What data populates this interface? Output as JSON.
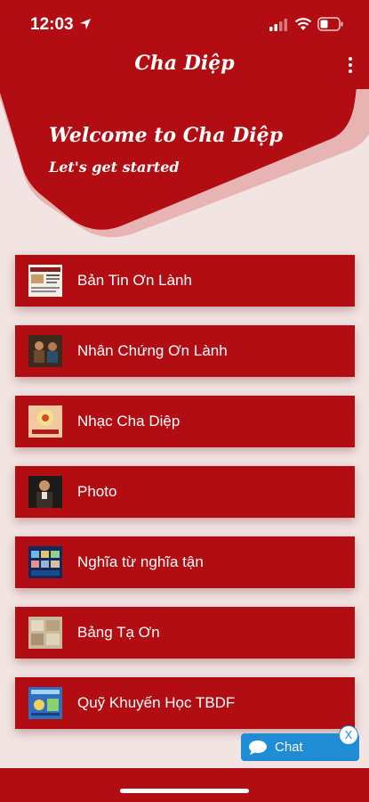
{
  "status_bar": {
    "time": "12:03"
  },
  "header": {
    "title": "Cha Diệp"
  },
  "banner": {
    "welcome": "Welcome to Cha Diệp",
    "subtitle": "Let's get started"
  },
  "menu": [
    {
      "label": "Bản Tin Ơn Lành",
      "icon": "newsletter-thumbnail"
    },
    {
      "label": "Nhân Chứng Ơn Lành",
      "icon": "witness-thumbnail"
    },
    {
      "label": "Nhạc Cha Diệp",
      "icon": "music-thumbnail"
    },
    {
      "label": "Photo",
      "icon": "photo-thumbnail"
    },
    {
      "label": "Nghĩa từ nghĩa tận",
      "icon": "video-thumbnail"
    },
    {
      "label": "Bảng Tạ Ơn",
      "icon": "thanks-board-thumbnail"
    },
    {
      "label": "Quỹ Khuyến Học TBDF",
      "icon": "scholarship-thumbnail"
    }
  ],
  "chat_widget": {
    "label": "Chat",
    "close": "X"
  },
  "colors": {
    "primary": "#b20d12",
    "background": "#f1e4e3",
    "chat": "#1f8dd6"
  }
}
